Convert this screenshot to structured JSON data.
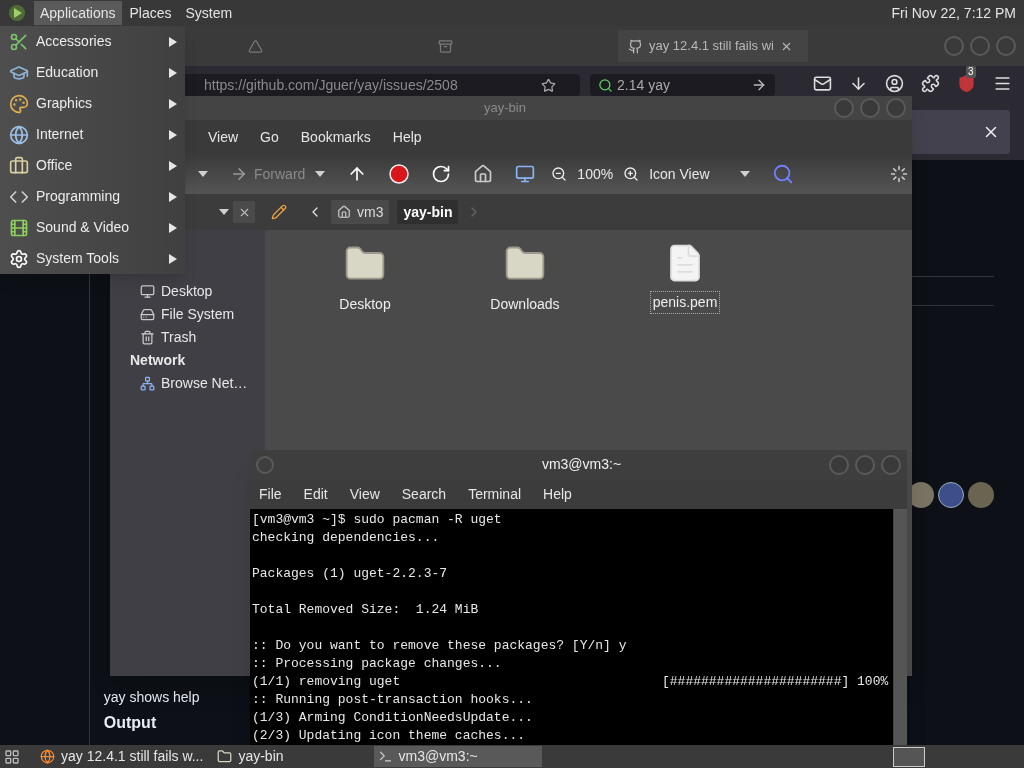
{
  "top_panel": {
    "menus": [
      {
        "label": "Applications",
        "selected": true
      },
      {
        "label": "Places",
        "selected": false
      },
      {
        "label": "System",
        "selected": false
      }
    ],
    "clock": "Fri Nov 22, 7:12 PM"
  },
  "applications_menu": {
    "items": [
      {
        "label": "Accessories",
        "kind": "accessories"
      },
      {
        "label": "Education",
        "kind": "education"
      },
      {
        "label": "Graphics",
        "kind": "graphics"
      },
      {
        "label": "Internet",
        "kind": "internet"
      },
      {
        "label": "Office",
        "kind": "office"
      },
      {
        "label": "Programming",
        "kind": "programming"
      },
      {
        "label": "Sound & Video",
        "kind": "media"
      },
      {
        "label": "System Tools",
        "kind": "system"
      }
    ]
  },
  "browser": {
    "tabs": [
      {
        "kind": "drive",
        "selected": false
      },
      {
        "kind": "archive",
        "selected": false
      },
      {
        "kind": "github",
        "label": "yay 12.4.1 still fails wi",
        "selected": true
      }
    ],
    "url": "https://github.com/Jguer/yay/issues/2508",
    "search_value": "2.14 yay",
    "extension_badge": "3",
    "page": {
      "description": "yay shows help",
      "output_heading": "Output"
    }
  },
  "file_manager": {
    "title": "yay-bin",
    "menus": [
      "View",
      "Go",
      "Bookmarks",
      "Help"
    ],
    "forward_label": "Forward",
    "zoom": "100%",
    "view_mode": "Icon View",
    "path": [
      {
        "label": "vm3",
        "selected": false
      },
      {
        "label": "yay-bin",
        "selected": true
      }
    ],
    "places": [
      {
        "label": "Desktop",
        "kind": "desktop"
      },
      {
        "label": "File System",
        "kind": "drive"
      },
      {
        "label": "Trash",
        "kind": "trash"
      }
    ],
    "network_heading": "Network",
    "network_items": [
      {
        "label": "Browse Net…",
        "kind": "network"
      }
    ],
    "files": [
      {
        "name": "Desktop",
        "kind": "desktop-folder",
        "focused": false
      },
      {
        "name": "Downloads",
        "kind": "folder",
        "focused": false
      },
      {
        "name": "penis.pem",
        "kind": "file",
        "focused": true
      }
    ]
  },
  "terminal": {
    "title": "vm3@vm3:~",
    "menus": [
      "File",
      "Edit",
      "View",
      "Search",
      "Terminal",
      "Help"
    ],
    "lines": [
      {
        "kind": "text",
        "text": "[vm3@vm3 ~]$ sudo pacman -R uget"
      },
      {
        "kind": "text",
        "text": "checking dependencies..."
      },
      {
        "kind": "blank"
      },
      {
        "kind": "text",
        "text": "Packages (1) uget-2.2.3-7"
      },
      {
        "kind": "blank"
      },
      {
        "kind": "text",
        "text": "Total Removed Size:  1.24 MiB"
      },
      {
        "kind": "blank"
      },
      {
        "kind": "text",
        "text": ":: Do you want to remove these packages? [Y/n] y"
      },
      {
        "kind": "text",
        "text": ":: Processing package changes..."
      },
      {
        "kind": "text",
        "text": "(1/1) removing uget",
        "progress": "[######################] 100%"
      },
      {
        "kind": "text",
        "text": ":: Running post-transaction hooks..."
      },
      {
        "kind": "text",
        "text": "(1/3) Arming ConditionNeedsUpdate..."
      },
      {
        "kind": "text",
        "text": "(2/3) Updating icon theme caches..."
      }
    ]
  },
  "taskbar": {
    "items": [
      {
        "label": "yay 12.4.1 still fails w...",
        "kind": "browser",
        "selected": false
      },
      {
        "label": "yay-bin",
        "kind": "folder",
        "selected": false
      },
      {
        "label": "vm3@vm3:~",
        "kind": "terminal",
        "selected": true
      }
    ]
  }
}
